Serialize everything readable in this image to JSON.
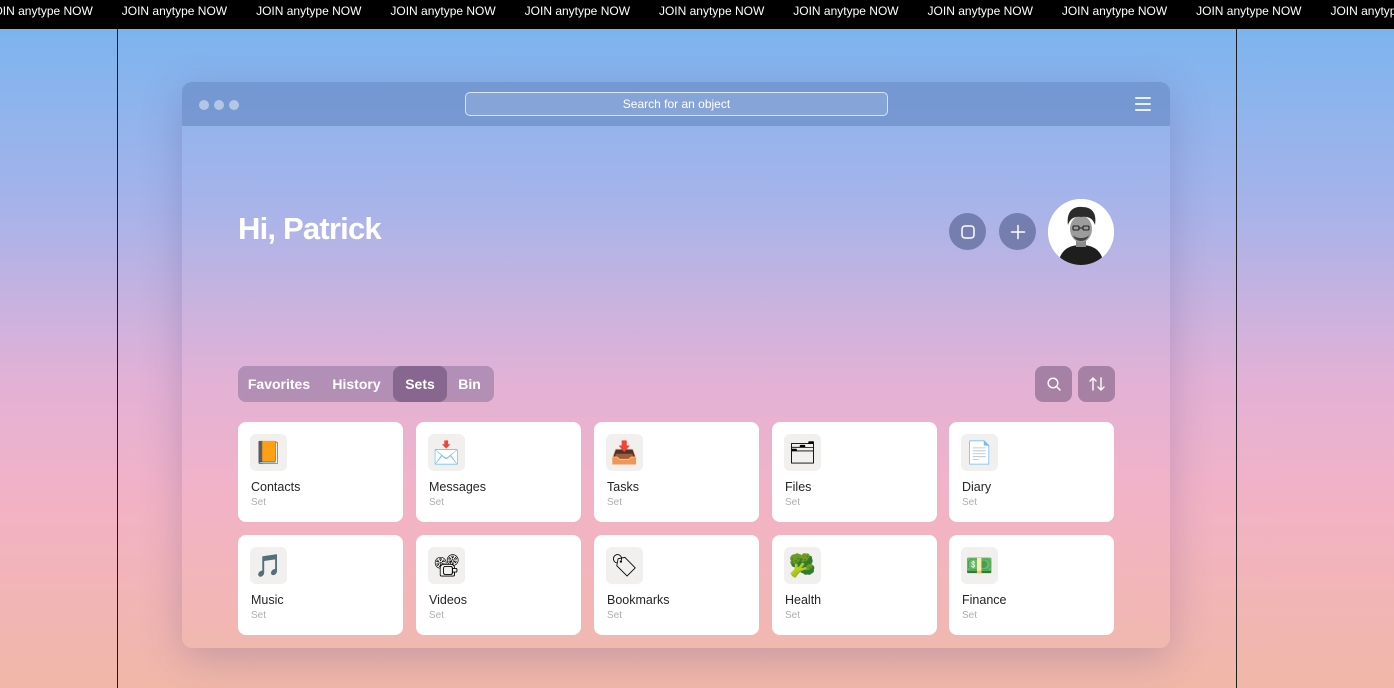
{
  "ticker": {
    "items": [
      "JOIN anytype NOW",
      "JOIN anytype NOW",
      "JOIN anytype NOW",
      "JOIN anytype NOW",
      "JOIN anytype NOW",
      "JOIN anytype NOW",
      "JOIN anytype NOW",
      "JOIN anytype NOW",
      "JOIN anytype NOW",
      "JOIN anytype NOW",
      "JOIN anytype NOW"
    ]
  },
  "window": {
    "search_text": "Search for an object",
    "greeting": "Hi, Patrick"
  },
  "tabs": [
    {
      "label": "Favorites",
      "active": false
    },
    {
      "label": "History",
      "active": false
    },
    {
      "label": "Sets",
      "active": true
    },
    {
      "label": "Bin",
      "active": false
    }
  ],
  "cards": [
    {
      "name": "Contacts",
      "type": "Set",
      "icon": "ledger-book-icon",
      "glyph": "📙"
    },
    {
      "name": "Messages",
      "type": "Set",
      "icon": "envelope-icon",
      "glyph": "📩"
    },
    {
      "name": "Tasks",
      "type": "Set",
      "icon": "inbox-tray-icon",
      "glyph": "📥"
    },
    {
      "name": "Files",
      "type": "Set",
      "icon": "folder-icon",
      "glyph": "🗂"
    },
    {
      "name": "Diary",
      "type": "Set",
      "icon": "page-icon",
      "glyph": "📄"
    },
    {
      "name": "Music",
      "type": "Set",
      "icon": "music-note-icon",
      "glyph": "🎵"
    },
    {
      "name": "Videos",
      "type": "Set",
      "icon": "film-projector-icon",
      "glyph": "📽"
    },
    {
      "name": "Bookmarks",
      "type": "Set",
      "icon": "bookmark-tag-icon",
      "glyph": "🏷"
    },
    {
      "name": "Health",
      "type": "Set",
      "icon": "broccoli-icon",
      "glyph": "🥦"
    },
    {
      "name": "Finance",
      "type": "Set",
      "icon": "dollar-banknote-icon",
      "glyph": "💵"
    }
  ],
  "colors": {
    "ticker_bg": "#000000",
    "titlebar": "#6082be",
    "card_bg": "#ffffff",
    "tab_active": "#785a82"
  }
}
